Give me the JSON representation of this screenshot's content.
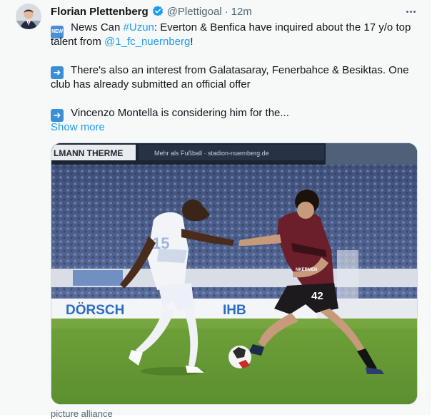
{
  "tweet": {
    "author_name": "Florian Plettenberg",
    "handle": "@Plettigoal",
    "separator": "·",
    "time": "12m",
    "line1_text": " News Can ",
    "line1_hashtag": "#Uzun",
    "line1_rest": ": Everton & Benfica have inquired about the 17 y/o top",
    "line2_text": "talent from ",
    "line2_mention": "@1_fc_nuernberg",
    "line2_end": "!",
    "line3_text": " There's also an interest from Galatasaray, Fenerbahce & Besiktas. One",
    "line4_text": "club has already submitted an official offer",
    "line5_text": " Vincenzo Montella is considering him for the...",
    "show_more": "Show more",
    "new_badge": "NEW",
    "image_caption": "picture alliance"
  },
  "photo": {
    "banner_1": "LMANN THERME",
    "banner_2": "Mehr als Fußball · stadion-nuernberg.de",
    "board_1": "DÖRSCH",
    "board_2": "IHB",
    "player_1_number": "15",
    "player_2_number": "42",
    "sponsor": "NKERMEN"
  },
  "colors": {
    "link": "#1d9bf0",
    "muted": "#536471",
    "verified": "#1d9bf0",
    "background": "#f7f9f9"
  },
  "icons": [
    "verified-badge-icon",
    "more-icon",
    "new-emoji-icon",
    "arrow-right-emoji-icon"
  ]
}
